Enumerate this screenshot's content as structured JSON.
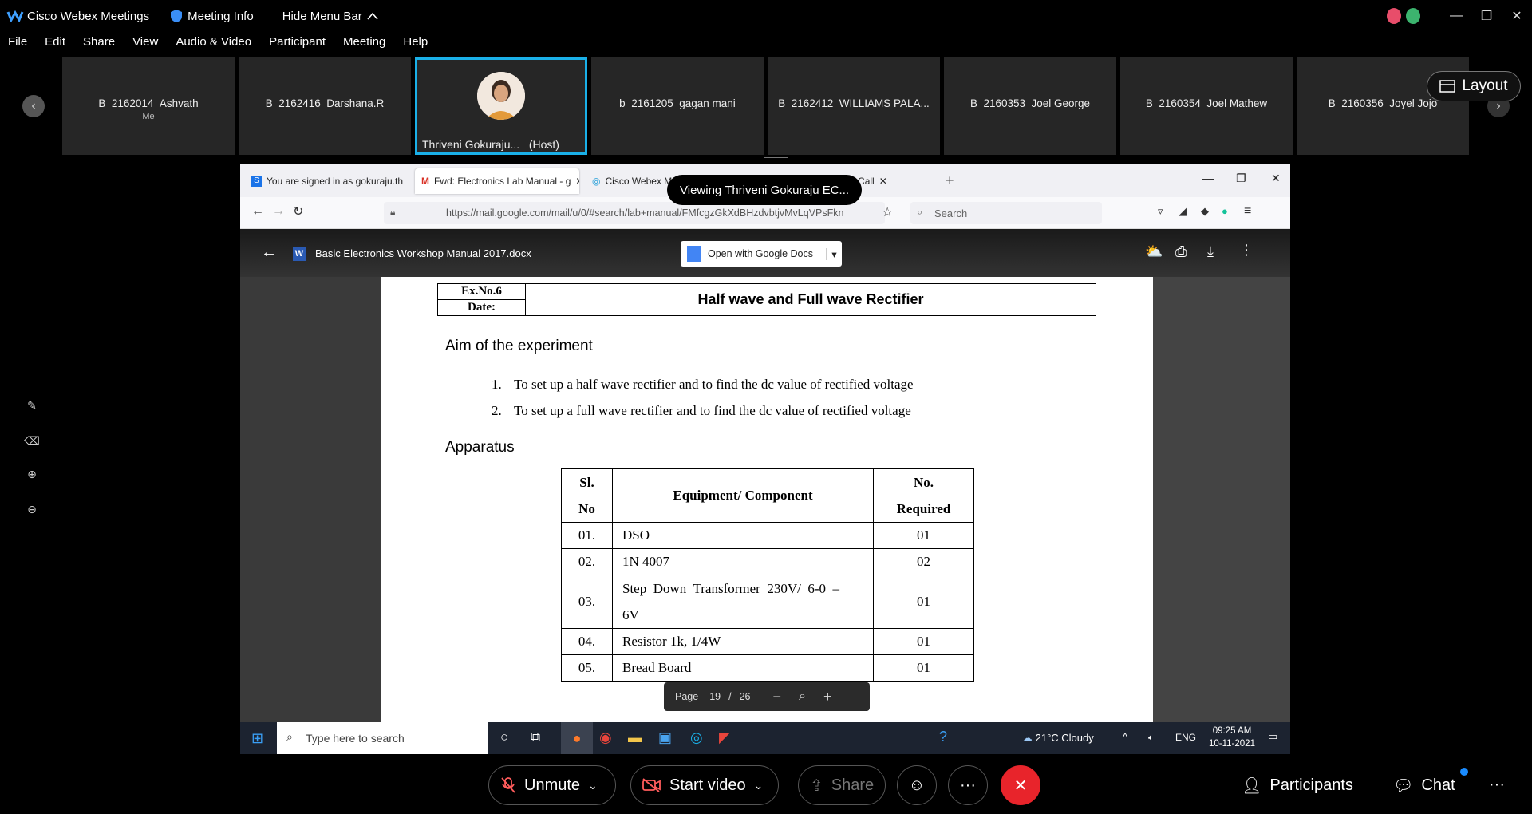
{
  "titlebar": {
    "app_name": "Cisco Webex Meetings",
    "meeting_info": "Meeting Info",
    "hide_menu": "Hide Menu Bar"
  },
  "menu": [
    "File",
    "Edit",
    "Share",
    "View",
    "Audio & Video",
    "Participant",
    "Meeting",
    "Help"
  ],
  "participants": [
    {
      "name": "B_2162014_Ashvath",
      "sub": "Me"
    },
    {
      "name": "B_2162416_Darshana.R",
      "sub": ""
    },
    {
      "name": "Thriveni Gokuraju...",
      "sub": "(Host)"
    },
    {
      "name": "b_2161205_gagan mani",
      "sub": ""
    },
    {
      "name": "B_2162412_WILLIAMS PALA...",
      "sub": ""
    },
    {
      "name": "B_2160353_Joel George",
      "sub": ""
    },
    {
      "name": "B_2160354_Joel Mathew",
      "sub": ""
    },
    {
      "name": "B_2160356_Joyel Jojo",
      "sub": ""
    }
  ],
  "layout_label": "Layout",
  "viewing_tip": "Viewing Thriveni Gokuraju EC...",
  "browser": {
    "tabs": [
      "You are signed in as gokuraju.th",
      "Fwd: Electronics Lab Manual - g",
      "Cisco Webex M",
      "g, Cloud Call"
    ],
    "url": "https://mail.google.com/mail/u/0/#search/lab+manual/FMfcgzGkXdBHzdvbtjvMvLqVPsFkn",
    "search_placeholder": "Search"
  },
  "viewer": {
    "doc_title": "Basic Electronics Workshop Manual 2017.docx",
    "open_with": "Open with Google Docs"
  },
  "doc": {
    "exno": "Ex.No.6",
    "date_label": "Date:",
    "title": "Half wave and Full wave Rectifier",
    "aim_heading": "Aim of the experiment",
    "aims": [
      {
        "num": "1.",
        "text": "To set up a half wave rectifier and to find the dc value of rectified voltage"
      },
      {
        "num": "2.",
        "text": "To set up a full wave rectifier and to find the dc value of rectified voltage"
      }
    ],
    "apparatus_heading": "Apparatus",
    "table_headers": {
      "sl": "Sl.",
      "no": "No",
      "equip": "Equipment/ Component",
      "req1": "No.",
      "req2": "Required"
    },
    "rows": [
      {
        "sl": "01.",
        "item": "DSO",
        "qty": "01"
      },
      {
        "sl": "02.",
        "item": "1N 4007",
        "qty": "02"
      },
      {
        "sl": "03.",
        "item": "Step  Down  Transformer  230V/  6-0  –",
        "item2": "6V",
        "qty": "01"
      },
      {
        "sl": "04.",
        "item": "Resistor 1k, 1/4W",
        "qty": "01"
      },
      {
        "sl": "05.",
        "item": "Bread Board",
        "qty": "01"
      }
    ]
  },
  "pager": {
    "label": "Page",
    "current": "19",
    "sep": "/",
    "total": "26"
  },
  "taskbar": {
    "search_placeholder": "Type here to search",
    "weather": "21°C  Cloudy",
    "lang": "ENG",
    "time": "09:25 AM",
    "date": "10-11-2021"
  },
  "controls": {
    "unmute": "Unmute",
    "start_video": "Start video",
    "share": "Share",
    "participants": "Participants",
    "chat": "Chat"
  },
  "colors": {
    "accent": "#1ab0e8",
    "end_call": "#e8242b",
    "mute_red": "#ff5c5c"
  }
}
